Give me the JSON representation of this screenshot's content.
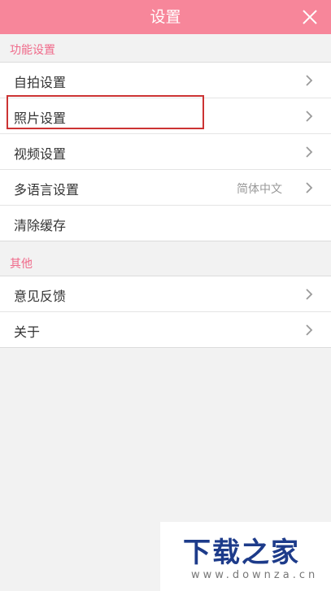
{
  "header": {
    "title": "设置",
    "close_icon": "close-icon"
  },
  "sections": [
    {
      "title": "功能设置",
      "items": [
        {
          "label": "自拍设置",
          "value": ""
        },
        {
          "label": "照片设置",
          "value": ""
        },
        {
          "label": "视频设置",
          "value": ""
        },
        {
          "label": "多语言设置",
          "value": "简体中文"
        },
        {
          "label": "清除缓存",
          "value": ""
        }
      ]
    },
    {
      "title": "其他",
      "items": [
        {
          "label": "意见反馈",
          "value": ""
        },
        {
          "label": "关于",
          "value": ""
        }
      ]
    }
  ],
  "watermark": {
    "main": "下载之家",
    "sub": "www.downza.cn"
  },
  "colors": {
    "header_bg": "#f7869a",
    "section_title": "#f06a8a",
    "highlight_border": "#cc3333"
  }
}
